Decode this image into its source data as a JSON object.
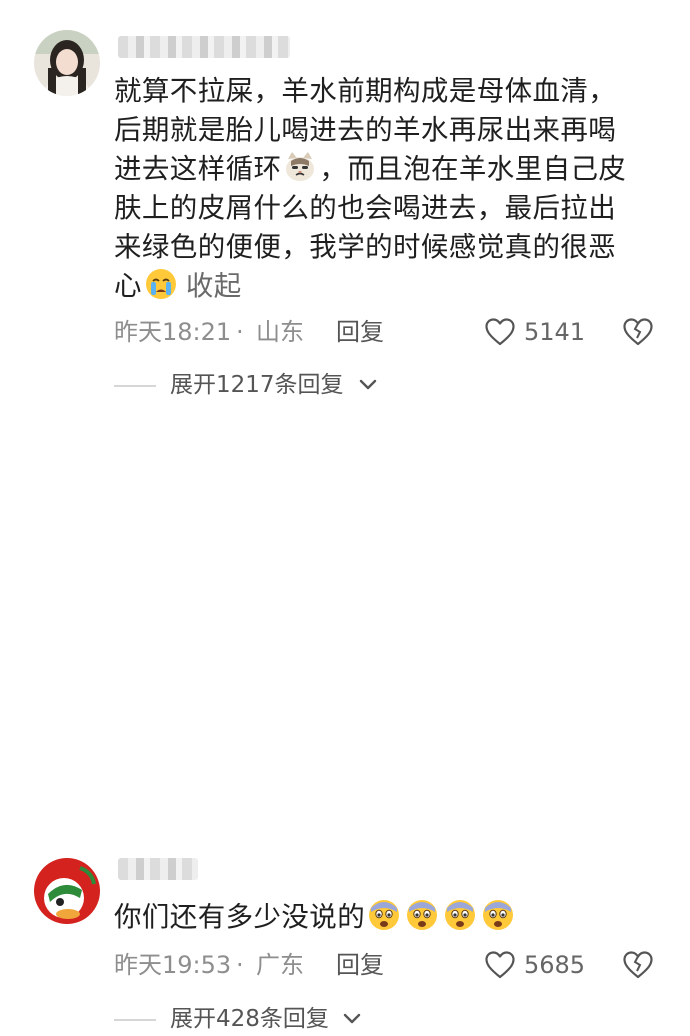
{
  "comments": [
    {
      "lines": [
        "就算不拉屎，羊水前期构成是母体血清，",
        "后期就是胎儿喝进去的羊水再尿出来再喝",
        "进去这样循环",
        "，而且泡在羊水里自己皮",
        "肤上的皮屑什么的也会喝进去，最后拉出",
        "来绿色的便便，我学的时候感觉真的很恶",
        "心"
      ],
      "emoji_1": "cat-emoji",
      "emoji_2": "crying-face-emoji",
      "collapse_label": "收起",
      "time": "昨天18:21",
      "separator": "·",
      "location": "山东",
      "reply_label": "回复",
      "like_count": "5141",
      "expand_label": "展开1217条回复"
    },
    {
      "text": "你们还有多少没说的",
      "emojis": [
        "fearful-face-emoji",
        "fearful-face-emoji",
        "fearful-face-emoji",
        "fearful-face-emoji"
      ],
      "time": "昨天19:53",
      "separator": "·",
      "location": "广东",
      "reply_label": "回复",
      "like_count": "5685",
      "expand_label": "展开428条回复"
    }
  ],
  "colors": {
    "text": "#1f1f1f",
    "meta": "#8e8e8e",
    "link": "#555555",
    "rule": "#d6d6d6"
  }
}
